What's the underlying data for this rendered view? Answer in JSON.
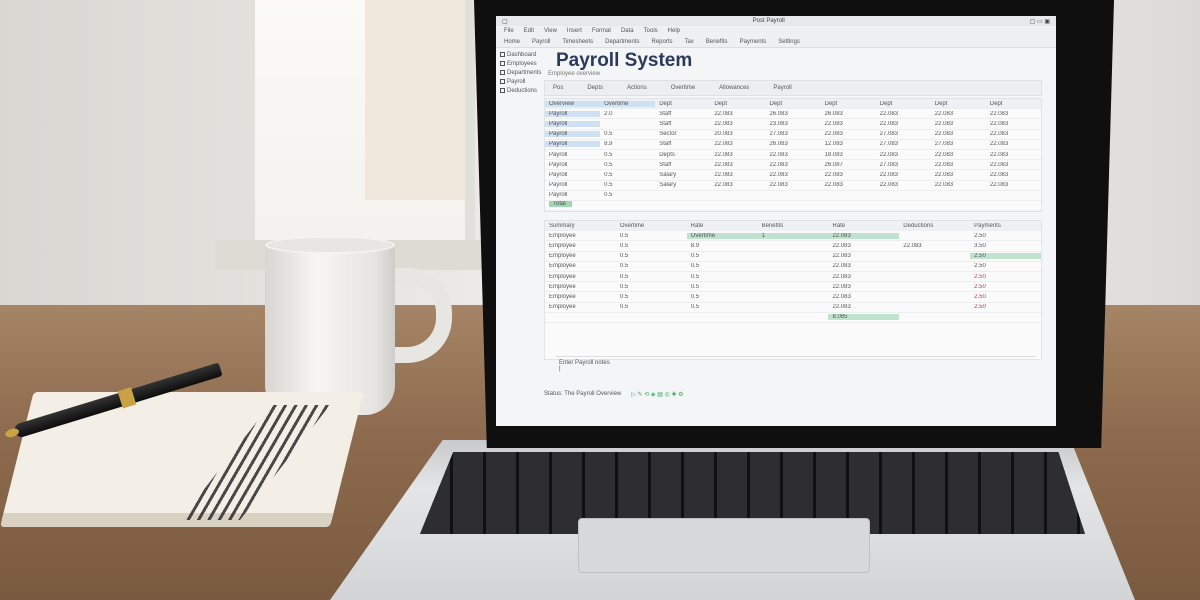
{
  "screen": {
    "window_title": "Post Payroll",
    "title": "Payroll System",
    "subtitle": "Employee overview",
    "menu": [
      "File",
      "Edit",
      "View",
      "Insert",
      "Format",
      "Data",
      "Tools",
      "Help"
    ],
    "bookmarks": [
      "Home",
      "Payroll",
      "Timesheets",
      "Departments",
      "Reports",
      "Tax",
      "Benefits",
      "Payments",
      "Settings"
    ],
    "sidebar": [
      "Dashboard",
      "Employees",
      "Departments",
      "Payroll",
      "Deductions"
    ],
    "tabs": [
      "Pos",
      "Depts",
      "Actions",
      "Overtime",
      "Allowances",
      "Payroll"
    ],
    "table": {
      "headers": [
        "Overview",
        "Overtime",
        "Dept",
        "Dept",
        "Dept",
        "Dept",
        "Dept",
        "Dept",
        "Dept"
      ],
      "rows": [
        [
          "Payroll",
          "2.0",
          "Staff",
          "22.083",
          "26.083",
          "26.083",
          "22.083",
          "22.083",
          "22.083"
        ],
        [
          "Payroll",
          "",
          "Staff",
          "22.083",
          "23.083",
          "22.083",
          "22.083",
          "22.083",
          "22.083"
        ],
        [
          "Payroll",
          "0.5",
          "Sector",
          "20.083",
          "27.083",
          "22.083",
          "27.083",
          "22.083",
          "22.083"
        ],
        [
          "Payroll",
          "8.9",
          "Staff",
          "22.083",
          "26.083",
          "12.083",
          "27.083",
          "27.083",
          "22.083"
        ],
        [
          "Payroll",
          "0.5",
          "Depts",
          "22.083",
          "22.083",
          "18.083",
          "22.083",
          "22.083",
          "22.083"
        ],
        [
          "Payroll",
          "0.5",
          "Staff",
          "22.083",
          "22.083",
          "26.087",
          "27.083",
          "22.083",
          "22.083"
        ],
        [
          "Payroll",
          "0.5",
          "Salary",
          "22.083",
          "22.083",
          "22.083",
          "22.083",
          "22.083",
          "22.083"
        ],
        [
          "Payroll",
          "0.5",
          "Salary",
          "22.083",
          "22.083",
          "22.083",
          "22.083",
          "22.083",
          "22.083"
        ],
        [
          "Payroll",
          "0.5",
          "",
          "",
          "",
          "",
          "",
          "",
          ""
        ]
      ],
      "total_label": "Total"
    },
    "lower": {
      "headers": [
        "Summary",
        "Overtime",
        "Rate",
        "Benefits",
        "Rate",
        "Deductions",
        "Payments"
      ],
      "rows": [
        [
          "Employee",
          "0.5",
          "Overtime",
          "1",
          "22.083",
          "",
          "2.50"
        ],
        [
          "Employee",
          "0.5",
          "8.9",
          "",
          "22.083",
          "22.083",
          "3.50"
        ],
        [
          "Employee",
          "0.5",
          "0.5",
          "",
          "22.083",
          "",
          "2.50"
        ],
        [
          "Employee",
          "0.5",
          "0.5",
          "",
          "22.083",
          "",
          "2.50"
        ],
        [
          "Employee",
          "0.5",
          "0.5",
          "",
          "22.083",
          "",
          "2.50"
        ],
        [
          "Employee",
          "0.5",
          "0.5",
          "",
          "22.083",
          "",
          "2.50"
        ],
        [
          "Employee",
          "0.5",
          "0.5",
          "",
          "22.083",
          "",
          "2.50"
        ],
        [
          "Employee",
          "0.5",
          "0.5",
          "",
          "22.083",
          "",
          "2.50"
        ]
      ],
      "total": "8.085"
    },
    "input_label": "Enter Payroll notes",
    "status": "Status: The Payroll Overview"
  },
  "colors": {
    "title": "#2b3a5c",
    "highlight": "#bfe3cf",
    "selection": "#cfe0f2"
  }
}
